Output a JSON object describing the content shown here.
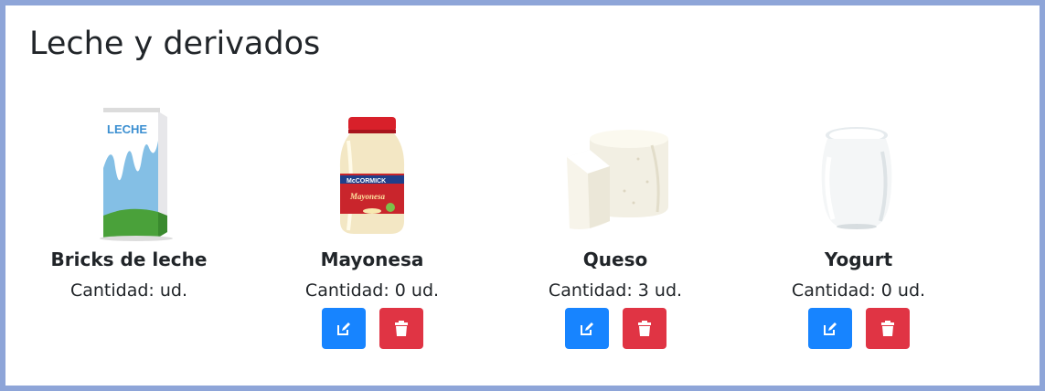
{
  "category": {
    "title": "Leche y derivados"
  },
  "products": [
    {
      "name": "Bricks de leche",
      "qty_label": "Cantidad: ud.",
      "image_icon": "milk-carton-image",
      "has_actions": false
    },
    {
      "name": "Mayonesa",
      "qty_label": "Cantidad: 0 ud.",
      "image_icon": "mayonnaise-jar-image",
      "has_actions": true
    },
    {
      "name": "Queso",
      "qty_label": "Cantidad: 3 ud.",
      "image_icon": "cheese-wheel-image",
      "has_actions": true
    },
    {
      "name": "Yogurt",
      "qty_label": "Cantidad: 0 ud.",
      "image_icon": "yogurt-jar-image",
      "has_actions": true
    }
  ],
  "milk_carton_logo": "LECHE",
  "mayo_label": {
    "brand": "McCORMICK",
    "name": "Mayonesa"
  },
  "actions": {
    "edit_icon": "edit-icon",
    "delete_icon": "trash-icon"
  },
  "colors": {
    "edit": "#1784ff",
    "delete": "#e03444",
    "border": "#8ea5d8",
    "text": "#212529"
  }
}
